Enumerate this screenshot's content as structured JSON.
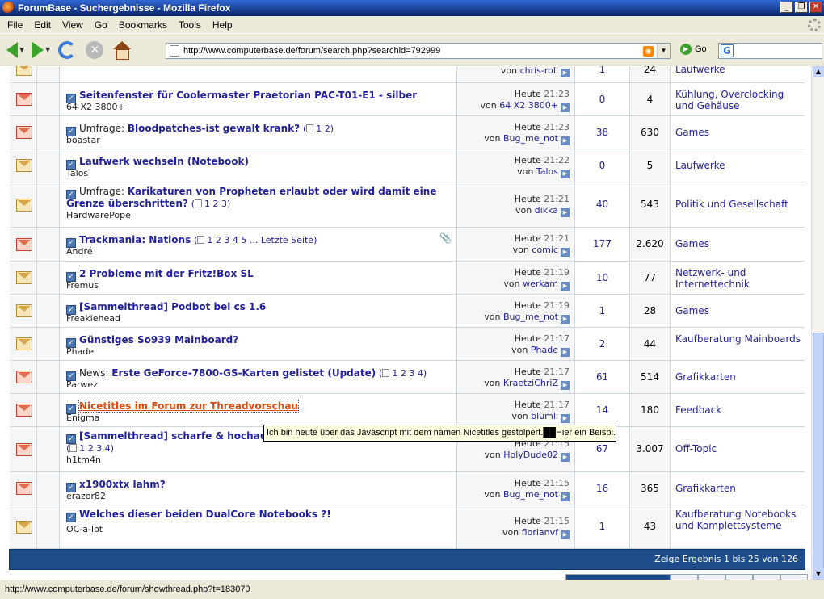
{
  "window": {
    "title": "ForumBase - Suchergebnisse - Mozilla Firefox",
    "controls": [
      "_",
      "❐",
      "✕"
    ]
  },
  "menu": [
    "File",
    "Edit",
    "View",
    "Go",
    "Bookmarks",
    "Tools",
    "Help"
  ],
  "nav": {
    "url": "http://www.computerbase.de/forum/search.php?searchid=792999",
    "go_label": "Go",
    "search_engine": "G"
  },
  "threads": [
    {
      "icon": "none",
      "prefix": "",
      "title": "",
      "pages": "",
      "author": "chris-roll",
      "time_day": "",
      "time": "",
      "by": "von",
      "last_user": "chris-roll",
      "replies": "1",
      "views": "24",
      "forum": "Laufwerke"
    },
    {
      "icon": "none",
      "prefix": "",
      "title": "Seitenfenster für Coolermaster Praetorian PAC-T01-E1 - silber",
      "pages": "",
      "author": "64 X2 3800+",
      "time_day": "Heute",
      "time": "21:23",
      "by": "von",
      "last_user": "64 X2 3800+",
      "replies": "0",
      "views": "4",
      "forum": "Kühlung, Overclocking und Gehäuse"
    },
    {
      "icon": "poll",
      "prefix": "Umfrage: ",
      "title": "Bloodpatches-ist gewalt krank?",
      "pages": "1 2",
      "author": "boastar",
      "time_day": "Heute",
      "time": "21:23",
      "by": "von",
      "last_user": "Bug_me_not",
      "replies": "38",
      "views": "630",
      "forum": "Games"
    },
    {
      "icon": "none",
      "prefix": "",
      "title": "Laufwerk wechseln (Notebook)",
      "pages": "",
      "author": "Talos",
      "time_day": "Heute",
      "time": "21:22",
      "by": "von",
      "last_user": "Talos",
      "replies": "0",
      "views": "5",
      "forum": "Laufwerke"
    },
    {
      "icon": "poll",
      "prefix": "Umfrage: ",
      "title": "Karikaturen von Propheten erlaubt oder wird damit eine",
      "title2": "Grenze überschritten?",
      "pages": "1 2 3",
      "author": "HardwarePope",
      "time_day": "Heute",
      "time": "21:21",
      "by": "von",
      "last_user": "dikka",
      "replies": "40",
      "views": "543",
      "forum": "Politik und Gesellschaft"
    },
    {
      "icon": "warn",
      "prefix": "",
      "title": "Trackmania: Nations",
      "pages": "1 2 3 4 5 ... Letzte Seite",
      "author": "André",
      "time_day": "Heute",
      "time": "21:21",
      "by": "von",
      "last_user": "comic",
      "replies": "177",
      "views": "2.620",
      "forum": "Games",
      "attach": "📎"
    },
    {
      "icon": "none",
      "prefix": "",
      "title": "2 Probleme mit der Fritz!Box SL",
      "pages": "",
      "author": "Fremus",
      "time_day": "Heute",
      "time": "21:19",
      "by": "von",
      "last_user": "werkam",
      "replies": "10",
      "views": "77",
      "forum": "Netzwerk- und Internettechnik"
    },
    {
      "icon": "none",
      "prefix": "",
      "title": "[Sammelthread] Podbot bei cs 1.6",
      "pages": "",
      "author": "Freakiehead",
      "time_day": "Heute",
      "time": "21:19",
      "by": "von",
      "last_user": "Bug_me_not",
      "replies": "1",
      "views": "28",
      "forum": "Games"
    },
    {
      "icon": "arrow",
      "prefix": "",
      "title": "Günstiges So939 Mainboard?",
      "pages": "",
      "author": "Phade",
      "time_day": "Heute",
      "time": "21:17",
      "by": "von",
      "last_user": "Phade",
      "replies": "2",
      "views": "44",
      "forum": "Kaufberatung Mainboards"
    },
    {
      "icon": "doc",
      "prefix": "News: ",
      "title": "Erste GeForce-7800-GS-Karten gelistet (Update)",
      "pages": "1 2 3 4",
      "author": "Parwez",
      "time_day": "Heute",
      "time": "21:17",
      "by": "von",
      "last_user": "KraetziChriZ",
      "replies": "61",
      "views": "514",
      "forum": "Grafikkarten"
    },
    {
      "icon": "none",
      "prefix": "",
      "title": "Nicetitles im Forum zur Threadvorschau",
      "pages": "",
      "author": "Enigma",
      "time_day": "Heute",
      "time": "21:17",
      "by": "von",
      "last_user": "blümli",
      "replies": "14",
      "views": "180",
      "forum": "Feedback",
      "hover": true
    },
    {
      "icon": "none",
      "prefix": "",
      "title": "[Sammelthread] scharfe & hochauflösende Hardwarebilder",
      "pages": "1 2 3 4",
      "author": "h1tm4n",
      "time_day": "Heute",
      "time": "21:15",
      "by": "von",
      "last_user": "HolyDude02",
      "replies": "67",
      "views": "3.007",
      "forum": "Off-Topic"
    },
    {
      "icon": "none",
      "prefix": "",
      "title": "x1900xtx lahm?",
      "pages": "",
      "author": "erazor82",
      "time_day": "Heute",
      "time": "21:15",
      "by": "von",
      "last_user": "Bug_me_not",
      "replies": "16",
      "views": "365",
      "forum": "Grafikkarten"
    },
    {
      "icon": "none",
      "prefix": "",
      "title": "Welches dieser beiden DualCore Notebooks ?!",
      "pages": "",
      "author": "OC-a-lot",
      "time_day": "Heute",
      "time": "21:15",
      "by": "von",
      "last_user": "florianvf",
      "replies": "1",
      "views": "43",
      "forum": "Kaufberatung Notebooks und Komplettsysteme"
    }
  ],
  "tooltip": "Ich bin heute über das Javascript mit dem namen Nicetitles gestolpert.██Hier ein Beispi...",
  "footer": "Zeige Ergebnis 1 bis 25 von 126",
  "status": "http://www.computerbase.de/forum/showthread.php?t=183070"
}
